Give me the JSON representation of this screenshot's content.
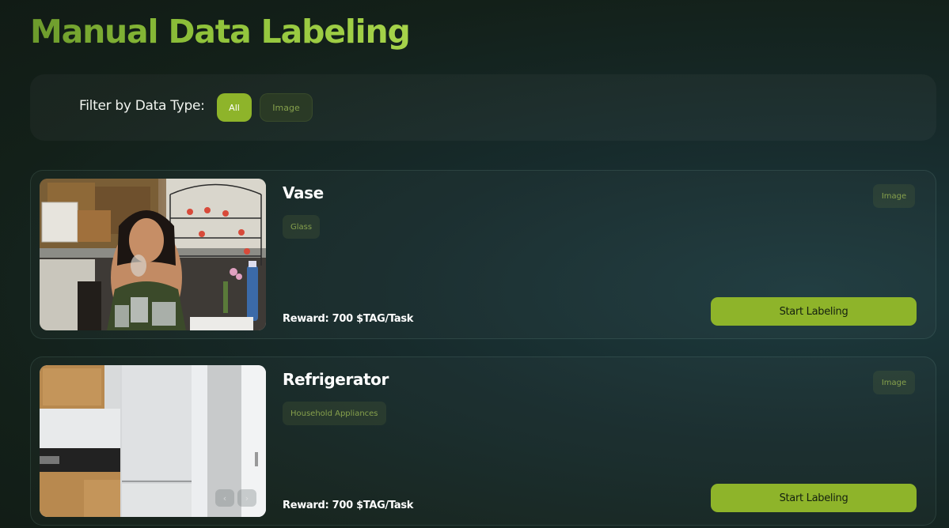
{
  "page": {
    "title": "Manual Data Labeling"
  },
  "filter": {
    "label": "Filter by Data Type:",
    "options": [
      {
        "label": "All",
        "active": true
      },
      {
        "label": "Image",
        "active": false
      }
    ]
  },
  "tasks": [
    {
      "title": "Vase",
      "tag": "Glass",
      "type": "Image",
      "reward": "Reward: 700 $TAG/Task",
      "button": "Start Labeling",
      "image_icon": "photo-icon"
    },
    {
      "title": "Refrigerator",
      "tag": "Household Appliances",
      "type": "Image",
      "reward": "Reward: 700 $TAG/Task",
      "button": "Start Labeling",
      "image_icon": "photo-icon",
      "gallery_nav": {
        "prev_icon": "chevron-left-icon",
        "next_icon": "chevron-right-icon"
      }
    }
  ],
  "colors": {
    "accent": "#8eb42a",
    "title_gradient_start": "#6c9a2c",
    "title_gradient_end": "#a6d34a",
    "tag_text": "#86a04c"
  }
}
